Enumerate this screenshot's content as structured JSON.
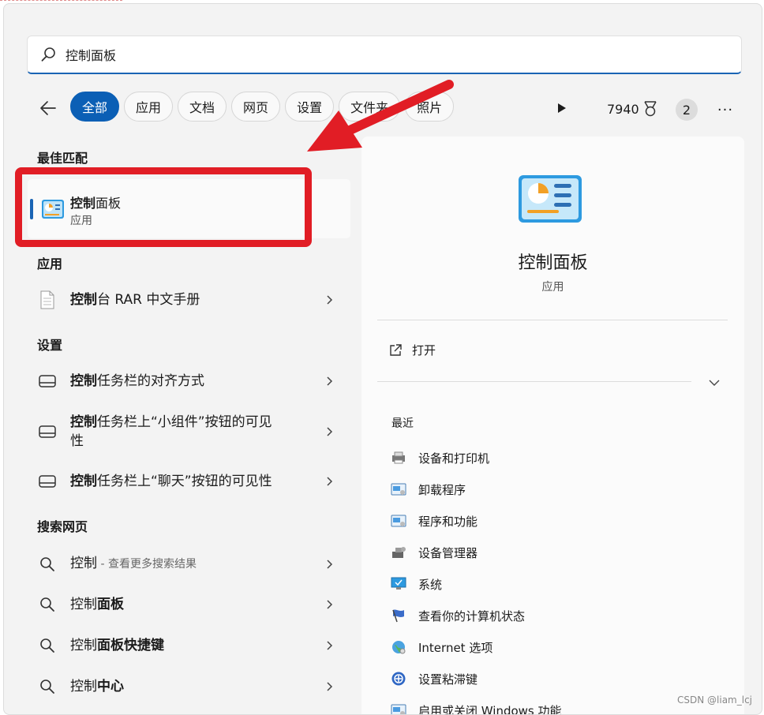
{
  "search": {
    "query": "控制面板"
  },
  "filters": {
    "back_label": "←",
    "chips": [
      "全部",
      "应用",
      "文档",
      "网页",
      "设置",
      "文件夹",
      "照片"
    ],
    "points": "7940",
    "badge": "2",
    "more": "···"
  },
  "results": {
    "best_match_header": "最佳匹配",
    "best_match": {
      "title_bold": "控制",
      "title_rest": "面板",
      "subtitle": "应用"
    },
    "apps_header": "应用",
    "apps": [
      {
        "bold": "控制",
        "rest": "台 RAR 中文手册"
      }
    ],
    "settings_header": "设置",
    "settings": [
      {
        "bold": "控制",
        "rest": "任务栏的对齐方式"
      },
      {
        "bold": "控制",
        "rest": "任务栏上“小组件”按钮的可见性"
      },
      {
        "bold": "控制",
        "rest": "任务栏上“聊天”按钮的可见性"
      }
    ],
    "web_header": "搜索网页",
    "web": [
      {
        "plain": "控制",
        "dim": " - 查看更多搜索结果",
        "bold": ""
      },
      {
        "plain": "控制",
        "bold": "面板",
        "dim": ""
      },
      {
        "plain": "控制",
        "bold": "面板快捷键",
        "dim": ""
      },
      {
        "plain": "控制",
        "bold": "中心",
        "dim": ""
      }
    ]
  },
  "detail": {
    "title": "控制面板",
    "subtitle": "应用",
    "open_label": "打开",
    "recent_header": "最近",
    "recent": [
      "设备和打印机",
      "卸载程序",
      "程序和功能",
      "设备管理器",
      "系统",
      "查看你的计算机状态",
      "Internet 选项",
      "设置粘滞键",
      "启用或关闭 Windows 功能"
    ]
  },
  "watermark": "CSDN @liam_lcj",
  "colors": {
    "accent": "#0b5fb5",
    "annotation_red": "#e11d25"
  }
}
